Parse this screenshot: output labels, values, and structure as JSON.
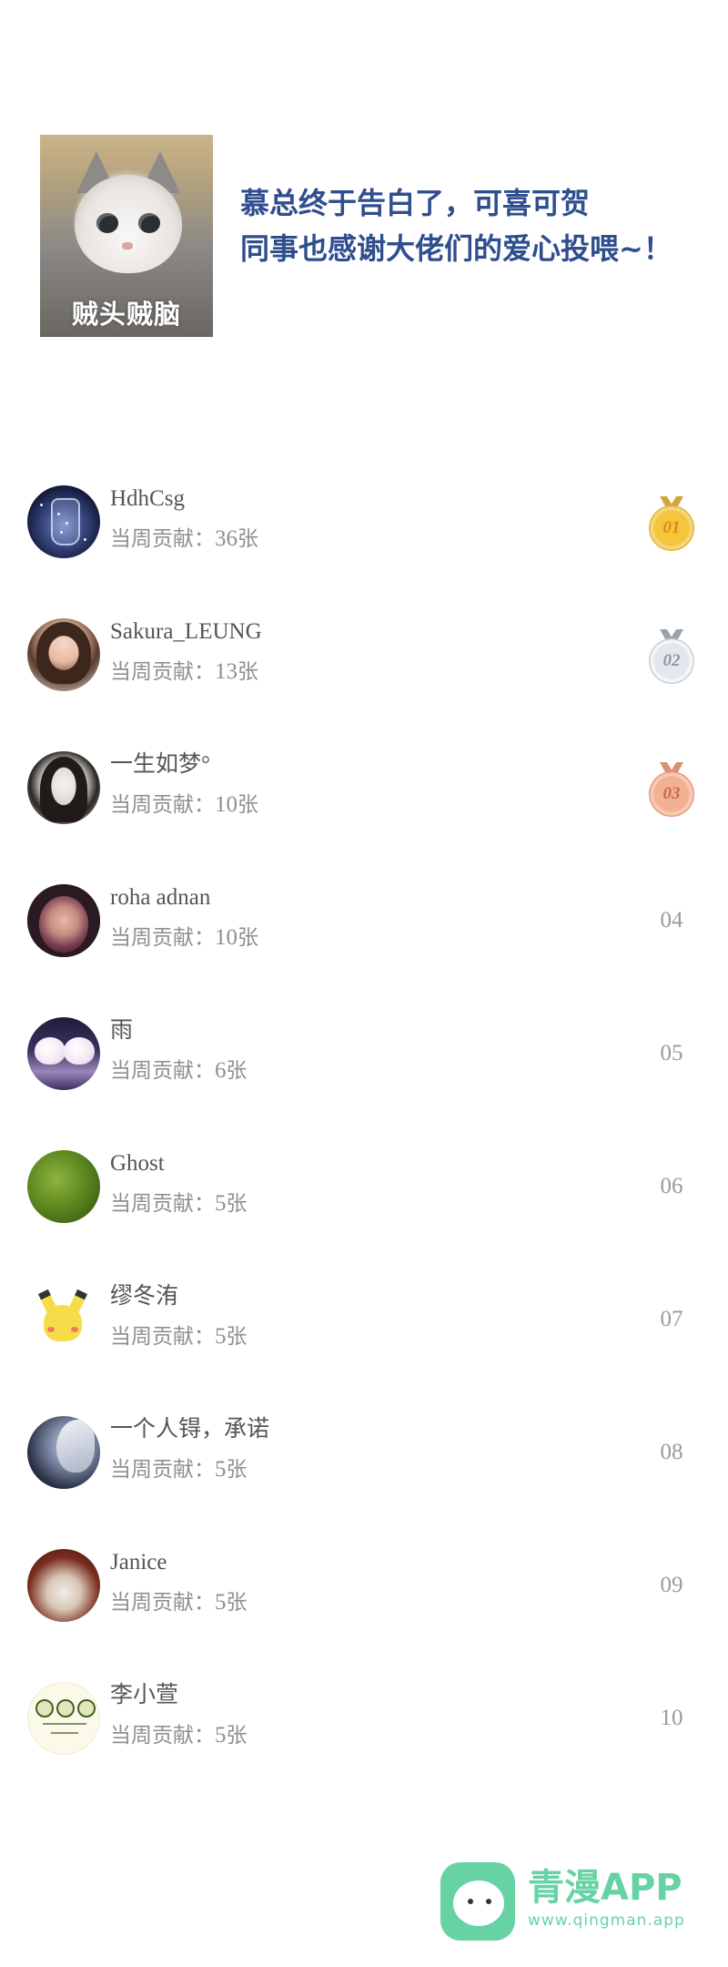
{
  "header": {
    "sticker_caption": "贼头贼脑",
    "headline_line1": "慕总终于告白了，可喜可贺",
    "headline_line2": "同事也感谢大佬们的爱心投喂~！"
  },
  "ranking": {
    "contribution_label": "当周贡献：",
    "unit": "张",
    "entries": [
      {
        "name": "HdhCsg",
        "count": "36",
        "rank": "01",
        "medal": "gold"
      },
      {
        "name": "Sakura_LEUNG",
        "count": "13",
        "rank": "02",
        "medal": "silver"
      },
      {
        "name": "一生如梦°",
        "count": "10",
        "rank": "03",
        "medal": "bronze"
      },
      {
        "name": "roha adnan",
        "count": "10",
        "rank": "04"
      },
      {
        "name": "雨",
        "count": "6",
        "rank": "05"
      },
      {
        "name": "Ghost",
        "count": "5",
        "rank": "06"
      },
      {
        "name": "缪冬洧",
        "count": "5",
        "rank": "07"
      },
      {
        "name": "一个人锝，承诺",
        "count": "5",
        "rank": "08"
      },
      {
        "name": "Janice",
        "count": "5",
        "rank": "09"
      },
      {
        "name": "李小萱",
        "count": "5",
        "rank": "10"
      }
    ]
  },
  "footer": {
    "brand": "青漫APP",
    "url": "www.qingman.app"
  },
  "colors": {
    "headline": "#2f4e8e",
    "brand_green": "#67d3a4"
  }
}
